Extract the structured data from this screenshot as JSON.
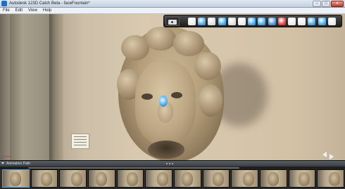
{
  "window": {
    "title": "Autodesk 123D Catch Beta - faceFountain*",
    "buttons": {
      "minimize": "–",
      "maximize": "□",
      "close": "x"
    }
  },
  "menu": {
    "items": [
      {
        "label": "File"
      },
      {
        "label": "Edit"
      },
      {
        "label": "View"
      },
      {
        "label": "Help"
      }
    ]
  },
  "toolbar": {
    "tools": [
      {
        "name": "select-tool",
        "icon": "pointer-icon",
        "color": "#e9e9e9"
      },
      {
        "name": "zoom-tool",
        "icon": "zoom-icon",
        "color": "#3aa0e6"
      },
      {
        "name": "pan-tool",
        "icon": "hand-icon",
        "color": "#dcdcdc"
      },
      {
        "name": "orbit-tool",
        "icon": "orbit-icon",
        "color": "#3aa0e6"
      },
      {
        "name": "lasso-tool",
        "icon": "lasso-icon",
        "color": "#dcdcdc"
      },
      {
        "name": "rotate-tool",
        "icon": "rotate-icon",
        "color": "#e8e8e8"
      },
      {
        "name": "frame-tool",
        "icon": "frame-icon",
        "color": "#3aa0e6"
      },
      {
        "name": "texture-tool",
        "icon": "texture-icon",
        "color": "#3aa0e6"
      },
      {
        "name": "email-tool",
        "icon": "envelope-icon",
        "color": "#3a8ad6"
      },
      {
        "name": "youtube-tool",
        "icon": "youtube-icon",
        "color": "#e12e2e"
      },
      {
        "name": "share-tool",
        "icon": "share-icon",
        "color": "#e8e8e8"
      },
      {
        "name": "measure-tool",
        "icon": "ruler-icon",
        "color": "#e8e8e8"
      },
      {
        "name": "mesh-tool",
        "icon": "mesh-icon",
        "color": "#3aa0e6"
      },
      {
        "name": "export-tool",
        "icon": "export-icon",
        "color": "#3aa0e6"
      },
      {
        "name": "settings-tool",
        "icon": "gear-icon",
        "color": "#e8e8e8"
      }
    ]
  },
  "viewport": {
    "cursor_icon": "hand-cursor-icon"
  },
  "filmstrip": {
    "label": "Animation Path",
    "thumbnail_count": 12,
    "selected_index": 0
  }
}
